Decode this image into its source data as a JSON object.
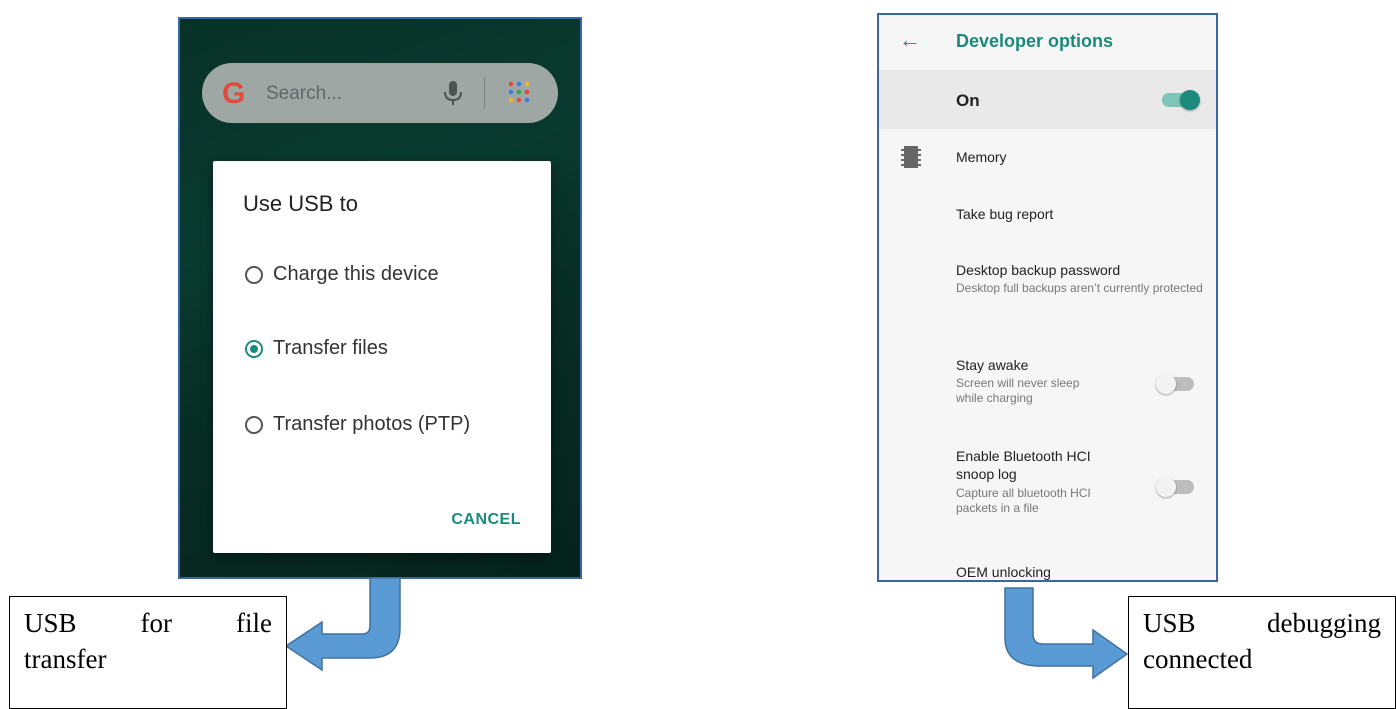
{
  "left_phone": {
    "search_bar": {
      "placeholder": "Search...",
      "logo": "G",
      "icons": [
        "mic-icon",
        "apps-grid-icon"
      ]
    },
    "dialog": {
      "title": "Use USB to",
      "options": [
        {
          "label": "Charge this device",
          "selected": false
        },
        {
          "label": "Transfer files",
          "selected": true
        },
        {
          "label": "Transfer photos (PTP)",
          "selected": false
        }
      ],
      "cancel_label": "CANCEL"
    }
  },
  "right_phone": {
    "app_bar": {
      "title": "Developer options",
      "back_icon": "back-arrow-icon"
    },
    "master_switch": {
      "label": "On",
      "checked": true
    },
    "prefs": [
      {
        "title": "Memory",
        "icon": "memory-chip-icon"
      },
      {
        "title": "Take bug report"
      },
      {
        "title": "Desktop backup password",
        "summary": "Desktop full backups aren’t currently protected"
      },
      {
        "title": "Stay awake",
        "summary": "Screen will never sleep while charging",
        "switch": false
      },
      {
        "title": "Enable Bluetooth HCI snoop log",
        "summary": "Capture all bluetooth HCI packets in a file",
        "switch": false
      },
      {
        "title": "OEM unlocking"
      }
    ]
  },
  "callouts": {
    "left": {
      "line1": [
        "USB",
        "for",
        "file"
      ],
      "line2": "transfer"
    },
    "right": {
      "line1": [
        "USB",
        "debugging"
      ],
      "line2": "connected"
    }
  },
  "colors": {
    "accent": "#1b8a7c",
    "arrow_fill": "#5b9bd5",
    "frame_border": "#3a66a8"
  }
}
